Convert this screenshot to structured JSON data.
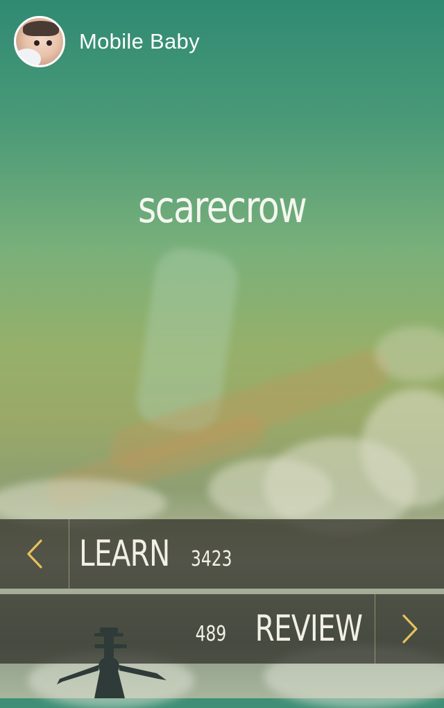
{
  "header": {
    "title": "Mobile Baby",
    "avatar_icon": "baby-avatar"
  },
  "main": {
    "word": "scarecrow"
  },
  "learn_bar": {
    "label": "LEARN",
    "count": "3423",
    "arrow_icon": "chevron-left-icon"
  },
  "review_bar": {
    "label": "REVIEW",
    "count": "489",
    "arrow_icon": "chevron-right-icon"
  },
  "colors": {
    "accent_arrow": "#e8c15a",
    "bar_background": "#2d2d26",
    "text": "#f2f0e6"
  }
}
